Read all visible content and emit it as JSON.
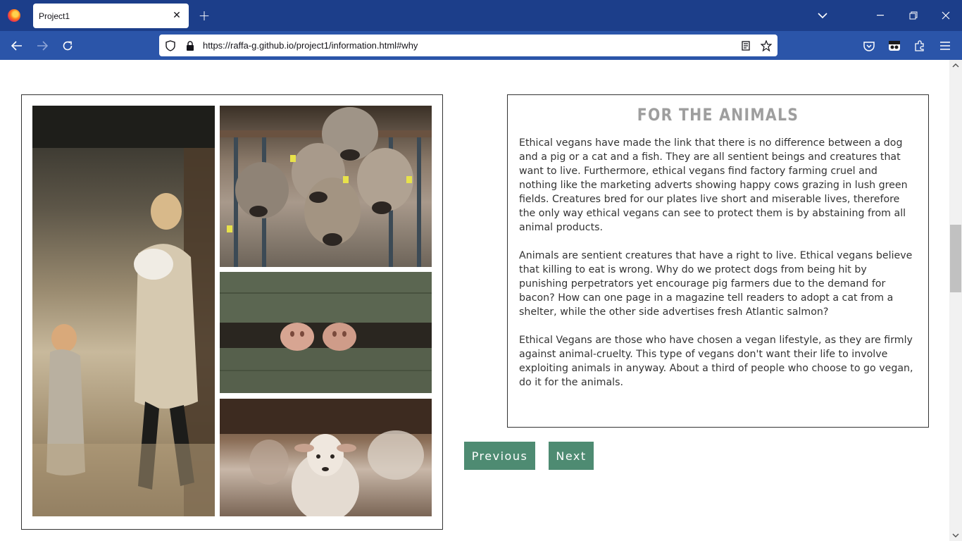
{
  "browser": {
    "tab_title": "Project1",
    "url": "https://raffa-g.github.io/project1/information.html#why"
  },
  "article": {
    "title": "FOR THE ANIMALS",
    "paragraphs": [
      "Ethical vegans have made the link that there is no difference between a dog and a pig or a cat and a fish. They are all sentient beings and creatures that want to live. Furthermore, ethical vegans find factory farming cruel and nothing like the marketing adverts showing happy cows grazing in lush green fields. Creatures bred for our plates live short and miserable lives, therefore the only way ethical vegans can see to protect them is by abstaining from all animal products.",
      "Animals are sentient creatures that have a right to live. Ethical vegans believe that killing to eat is wrong. Why do we protect dogs from being hit by punishing perpetrators yet encourage pig farmers due to the demand for bacon? How can one page in a magazine tell readers to adopt a cat from a shelter, while the other side advertises fresh Atlantic salmon?",
      "Ethical Vegans are those who have chosen a vegan lifestyle, as they are firmly against animal-cruelty. This type of vegans don't want their life to involve exploiting animals in anyway. About a third of people who choose to go vegan, do it for the animals."
    ]
  },
  "navigation": {
    "previous_label": "Previous",
    "next_label": "Next"
  },
  "colors": {
    "button_bg": "#4e8b72",
    "title_color": "#9e9e9e",
    "tabbar_bg": "#1c3e8a",
    "navbar_bg": "#2b55a9"
  }
}
